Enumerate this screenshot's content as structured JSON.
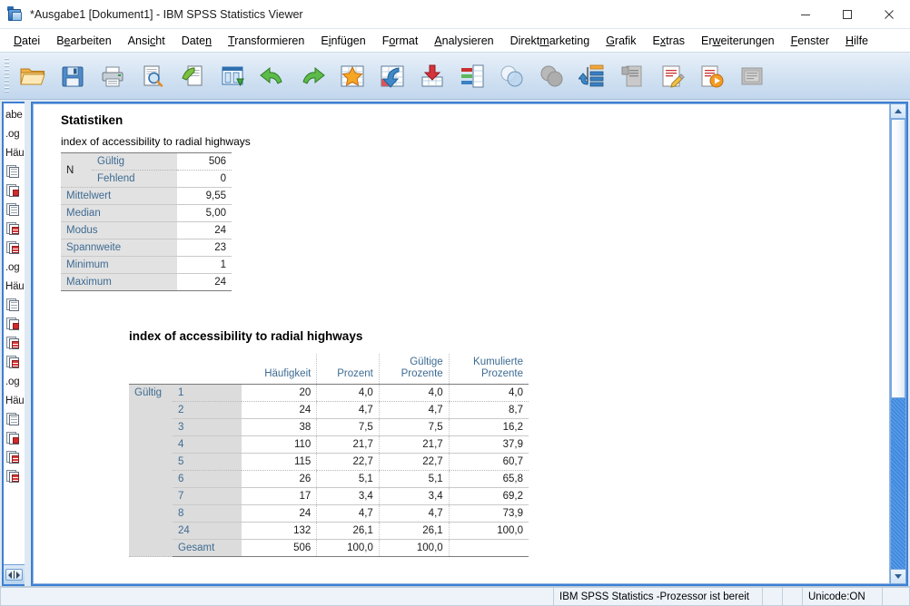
{
  "window": {
    "title": "*Ausgabe1 [Dokument1] - IBM SPSS Statistics Viewer",
    "icon": "spss-viewer-icon",
    "minimize_label": "—",
    "maximize_label": "□",
    "close_label": "✕"
  },
  "menubar": {
    "items": [
      {
        "label": "Datei",
        "pre": "",
        "mnemonic": "D",
        "post": "atei"
      },
      {
        "label": "Bearbeiten",
        "pre": "B",
        "mnemonic": "e",
        "post": "arbeiten"
      },
      {
        "label": "Ansicht",
        "pre": "Ansi",
        "mnemonic": "c",
        "post": "ht"
      },
      {
        "label": "Daten",
        "pre": "Date",
        "mnemonic": "n",
        "post": ""
      },
      {
        "label": "Transformieren",
        "pre": "",
        "mnemonic": "T",
        "post": "ransformieren"
      },
      {
        "label": "Einfügen",
        "pre": "E",
        "mnemonic": "i",
        "post": "nfügen"
      },
      {
        "label": "Format",
        "pre": "F",
        "mnemonic": "o",
        "post": "rmat"
      },
      {
        "label": "Analysieren",
        "pre": "",
        "mnemonic": "A",
        "post": "nalysieren"
      },
      {
        "label": "Direktmarketing",
        "pre": "Direkt",
        "mnemonic": "m",
        "post": "arketing"
      },
      {
        "label": "Grafik",
        "pre": "",
        "mnemonic": "G",
        "post": "rafik"
      },
      {
        "label": "Extras",
        "pre": "E",
        "mnemonic": "x",
        "post": "tras"
      },
      {
        "label": "Erweiterungen",
        "pre": "Er",
        "mnemonic": "w",
        "post": "eiterungen"
      },
      {
        "label": "Fenster",
        "pre": "",
        "mnemonic": "F",
        "post": "enster"
      },
      {
        "label": "Hilfe",
        "pre": "",
        "mnemonic": "H",
        "post": "ilfe"
      }
    ]
  },
  "toolbar": {
    "buttons": [
      {
        "name": "open-file-icon",
        "tooltip": "Datei öffnen"
      },
      {
        "name": "save-icon",
        "tooltip": "Speichern"
      },
      {
        "name": "print-icon",
        "tooltip": "Drucken"
      },
      {
        "name": "print-preview-icon",
        "tooltip": "Druckvorschau"
      },
      {
        "name": "export-document-icon",
        "tooltip": "Exportieren"
      },
      {
        "name": "dialog-recall-icon",
        "tooltip": "Dialogfeld aufrufen"
      },
      {
        "name": "undo-icon",
        "tooltip": "Rückgängig"
      },
      {
        "name": "redo-icon",
        "tooltip": "Wiederholen"
      },
      {
        "name": "goto-chart-icon",
        "tooltip": "Zu Diagramm wechseln"
      },
      {
        "name": "goto-data-icon",
        "tooltip": "Zu Daten wechseln"
      },
      {
        "name": "insert-table-icon",
        "tooltip": "Einfügen"
      },
      {
        "name": "pivot-table-icon",
        "tooltip": "Pivot-Tabelle"
      },
      {
        "name": "show-hide-icon",
        "tooltip": "Anzeigen/Ausblenden"
      },
      {
        "name": "select-groups-icon",
        "tooltip": "Gruppen auswählen"
      },
      {
        "name": "promote-outline-icon",
        "tooltip": "Höherstufen"
      },
      {
        "name": "insert-heading-icon",
        "tooltip": "Überschrift einfügen"
      },
      {
        "name": "insert-title-icon",
        "tooltip": "Titel einfügen"
      },
      {
        "name": "insert-text-icon",
        "tooltip": "Text einfügen"
      },
      {
        "name": "run-script-icon",
        "tooltip": "Skript ausführen"
      },
      {
        "name": "model-viewer-icon",
        "tooltip": "Modellansicht"
      }
    ]
  },
  "outline": {
    "rows": [
      {
        "type": "text",
        "text": "abe",
        "icon": ""
      },
      {
        "type": "text",
        "text": ".og",
        "icon": ""
      },
      {
        "type": "text",
        "text": "Häu",
        "icon": ""
      },
      {
        "type": "icon",
        "text": "",
        "icon": "output-page-icon"
      },
      {
        "type": "icon",
        "text": "",
        "icon": "output-table-red-icon"
      },
      {
        "type": "icon",
        "text": "",
        "icon": "output-notes-icon"
      },
      {
        "type": "icon",
        "text": "",
        "icon": "output-statistics-icon"
      },
      {
        "type": "icon",
        "text": "",
        "icon": "output-frequency-icon"
      },
      {
        "type": "text",
        "text": ".og",
        "icon": ""
      },
      {
        "type": "text",
        "text": "Häu",
        "icon": ""
      },
      {
        "type": "icon",
        "text": "",
        "icon": "output-page-icon"
      },
      {
        "type": "icon",
        "text": "",
        "icon": "output-table-red-icon"
      },
      {
        "type": "icon",
        "text": "",
        "icon": "output-statistics-icon"
      },
      {
        "type": "icon",
        "text": "",
        "icon": "output-frequency-icon"
      },
      {
        "type": "text",
        "text": ".og",
        "icon": ""
      },
      {
        "type": "text",
        "text": "Häu",
        "icon": ""
      },
      {
        "type": "icon",
        "text": "",
        "icon": "output-page-icon"
      },
      {
        "type": "icon",
        "text": "",
        "icon": "output-table-red-icon"
      },
      {
        "type": "icon",
        "text": "",
        "icon": "output-statistics-icon"
      },
      {
        "type": "icon",
        "text": "",
        "icon": "output-frequency-icon"
      }
    ]
  },
  "statistics_table": {
    "title": "Statistiken",
    "subtitle": "index of accessibility to radial highways",
    "rows": [
      {
        "group": "N",
        "label": "Gültig",
        "value": "506"
      },
      {
        "group": "",
        "label": "Fehlend",
        "value": "0"
      },
      {
        "group": "",
        "label": "Mittelwert",
        "value": "9,55"
      },
      {
        "group": "",
        "label": "Median",
        "value": "5,00"
      },
      {
        "group": "",
        "label": "Modus",
        "value": "24"
      },
      {
        "group": "",
        "label": "Spannweite",
        "value": "23"
      },
      {
        "group": "",
        "label": "Minimum",
        "value": "1"
      },
      {
        "group": "",
        "label": "Maximum",
        "value": "24"
      }
    ]
  },
  "frequency_table": {
    "title": "index of accessibility to radial highways",
    "columns": [
      "Häufigkeit",
      "Prozent",
      "Gültige Prozente",
      "Kumulierte Prozente"
    ],
    "column_lines": [
      [
        "Häufigkeit",
        ""
      ],
      [
        "Prozent",
        ""
      ],
      [
        "Gültige",
        "Prozente"
      ],
      [
        "Kumulierte",
        "Prozente"
      ]
    ],
    "group_label": "Gültig",
    "rows": [
      {
        "label": "1",
        "haeufigkeit": "20",
        "prozent": "4,0",
        "gueltige": "4,0",
        "kumulierte": "4,0"
      },
      {
        "label": "2",
        "haeufigkeit": "24",
        "prozent": "4,7",
        "gueltige": "4,7",
        "kumulierte": "8,7"
      },
      {
        "label": "3",
        "haeufigkeit": "38",
        "prozent": "7,5",
        "gueltige": "7,5",
        "kumulierte": "16,2"
      },
      {
        "label": "4",
        "haeufigkeit": "110",
        "prozent": "21,7",
        "gueltige": "21,7",
        "kumulierte": "37,9"
      },
      {
        "label": "5",
        "haeufigkeit": "115",
        "prozent": "22,7",
        "gueltige": "22,7",
        "kumulierte": "60,7"
      },
      {
        "label": "6",
        "haeufigkeit": "26",
        "prozent": "5,1",
        "gueltige": "5,1",
        "kumulierte": "65,8"
      },
      {
        "label": "7",
        "haeufigkeit": "17",
        "prozent": "3,4",
        "gueltige": "3,4",
        "kumulierte": "69,2"
      },
      {
        "label": "8",
        "haeufigkeit": "24",
        "prozent": "4,7",
        "gueltige": "4,7",
        "kumulierte": "73,9"
      },
      {
        "label": "24",
        "haeufigkeit": "132",
        "prozent": "26,1",
        "gueltige": "26,1",
        "kumulierte": "100,0"
      },
      {
        "label": "Gesamt",
        "haeufigkeit": "506",
        "prozent": "100,0",
        "gueltige": "100,0",
        "kumulierte": ""
      }
    ]
  },
  "statusbar": {
    "processor": "IBM SPSS Statistics -Prozessor ist bereit",
    "spacer1": "",
    "spacer2": "",
    "unicode": "Unicode:ON",
    "spacer3": ""
  },
  "colors": {
    "accent_border": "#3e7fd1",
    "scrollbar_track": "#3f8ae0",
    "table_label_text": "#3d6b92",
    "table_label_bg": "#dcdcdc",
    "toolbar_gradient_top": "#e8f0f9",
    "toolbar_gradient_bottom": "#c2d7ee"
  }
}
